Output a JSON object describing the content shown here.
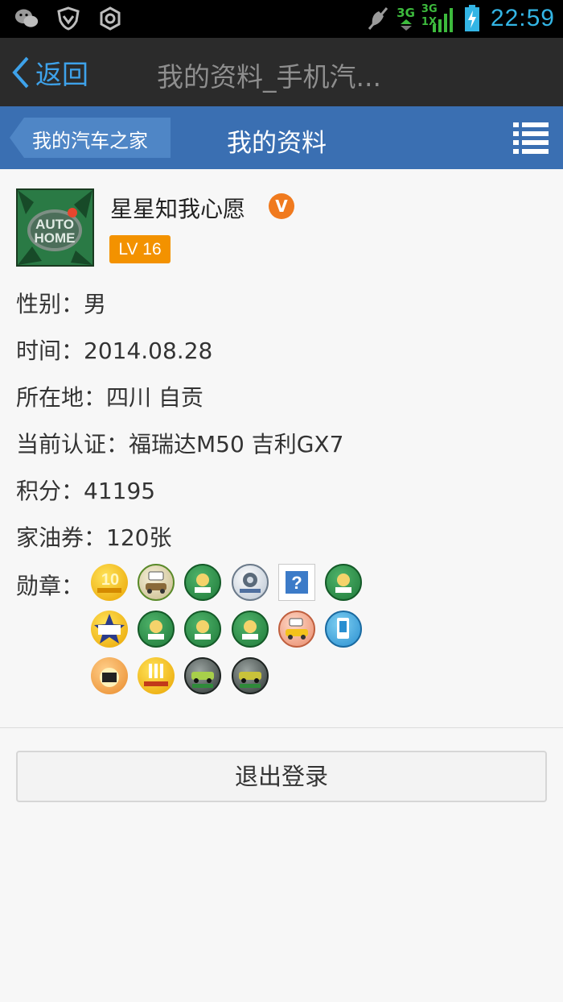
{
  "status_bar": {
    "time": "22:59",
    "network_1": "3G",
    "network_2": "3G",
    "network_2_sub": "1X",
    "icons": [
      "wechat-icon",
      "shield-icon",
      "settings-icon",
      "mute-icon",
      "signal-icon",
      "battery-icon"
    ]
  },
  "title_bar": {
    "back_label": "返回",
    "title": "我的资料_手机汽..."
  },
  "nav_bar": {
    "crumb": "我的汽车之家",
    "title": "我的资料",
    "accent": "#3a6fb2"
  },
  "profile": {
    "username": "星星知我心愿",
    "verified_mark": "V",
    "level": "LV 16",
    "gender": "性别：男",
    "time": "时间：2014.08.28",
    "location": "所在地：四川 自贡",
    "certification": "当前认证：福瑞达M50   吉利GX7",
    "points": "积分：41195",
    "coupons": "家油券：120张",
    "medal_label": "勋章："
  },
  "medals": {
    "row1": [
      "medal-10-gold",
      "medal-car-owner",
      "medal-green-worker",
      "medal-review",
      "medal-unknown",
      "medal-green-worker"
    ],
    "row2": [
      "medal-zhuijia",
      "medal-green-worker",
      "medal-green-worker",
      "medal-green-worker",
      "medal-taxi",
      "medal-phone"
    ],
    "row3": [
      "medal-zan",
      "medal-price-first",
      "medal-car-price",
      "medal-car-price-2"
    ]
  },
  "actions": {
    "logout": "退出登录"
  }
}
